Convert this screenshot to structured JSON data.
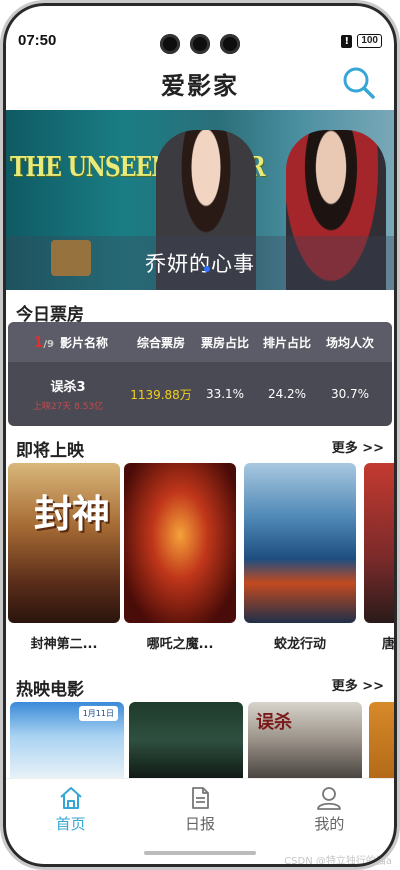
{
  "status_bar": {
    "time": "07:50",
    "alert_icon": "!",
    "battery": "100"
  },
  "header": {
    "title": "爱影家",
    "search_icon": "search-icon"
  },
  "banner": {
    "poster_title": "THE UNSEEN SISTER",
    "caption": "乔妍的心事"
  },
  "boxoffice": {
    "section_title": "今日票房",
    "pager_current": "1",
    "pager_total": "/9",
    "headers": [
      "影片名称",
      "综合票房",
      "票房占比",
      "排片占比",
      "场均人次"
    ],
    "row": {
      "name": "误杀3",
      "sub": "上映27天 8.53亿",
      "gross": "1139.88万",
      "box_share": "33.1%",
      "screen_share": "24.2%",
      "avg_attendance": "30.7%"
    }
  },
  "upcoming": {
    "section_title": "即将上映",
    "more": "更多 >>",
    "items": [
      {
        "name": "封神第二..."
      },
      {
        "name": "哪吒之魔..."
      },
      {
        "name": "蛟龙行动"
      },
      {
        "name": "唐"
      }
    ],
    "poster_text": "封神"
  },
  "hot": {
    "section_title": "热映电影",
    "more": "更多 >>",
    "tag1": "1月11日",
    "tag3": "误杀"
  },
  "tabbar": {
    "tabs": [
      {
        "label": "首页",
        "icon": "home-icon",
        "active": true
      },
      {
        "label": "日报",
        "icon": "document-icon",
        "active": false
      },
      {
        "label": "我的",
        "icon": "user-icon",
        "active": false
      }
    ]
  },
  "watermark": "CSDN @特立独行的猫a",
  "colors": {
    "accent": "#36a6d6",
    "gross_yellow": "#f2d11a",
    "pager_red": "#e03030"
  }
}
